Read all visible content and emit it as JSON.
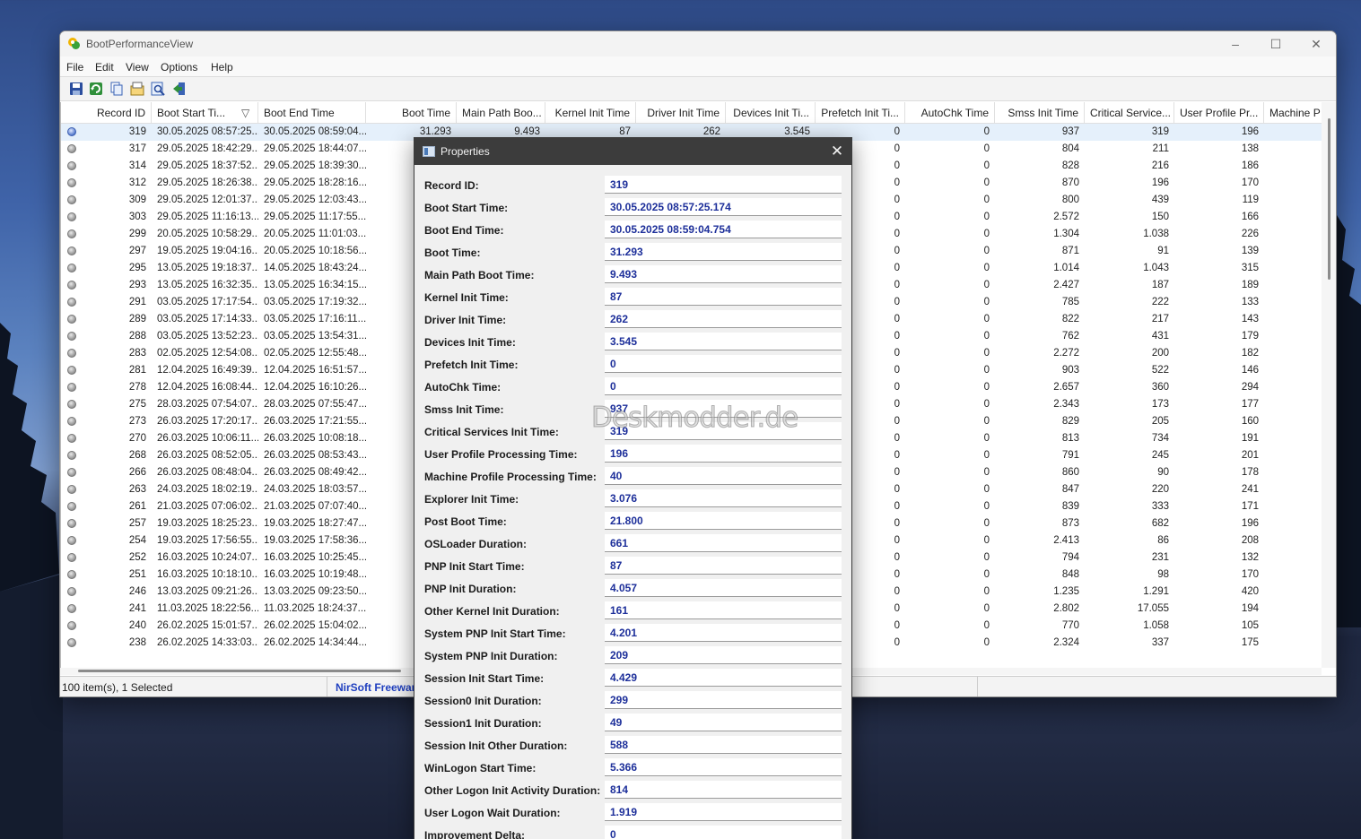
{
  "window": {
    "title": "BootPerformanceView",
    "controls": {
      "minimize": "–",
      "maximize": "☐",
      "close": "✕"
    }
  },
  "menu": [
    "File",
    "Edit",
    "View",
    "Options",
    "Help"
  ],
  "toolbar_icons": [
    "save-icon",
    "refresh-icon",
    "copy-icon",
    "properties-icon",
    "find-icon",
    "exit-icon"
  ],
  "columns": [
    "Record ID",
    "Boot Start Ti...",
    "Boot End Time",
    "Boot Time",
    "Main Path Boo...",
    "Kernel Init Time",
    "Driver Init Time",
    "Devices Init Ti...",
    "Prefetch Init Ti...",
    "AutoChk Time",
    "Smss Init Time",
    "Critical Service...",
    "User Profile Pr...",
    "Machine P"
  ],
  "sort_indicator": "▽",
  "rows": [
    {
      "id": "319",
      "start": "30.05.2025 08:57:25...",
      "end": "30.05.2025 08:59:04...",
      "boot": "31.293",
      "main": "9.493",
      "kernel": "87",
      "driver": "262",
      "devices": "3.545",
      "prefetch": "0",
      "autochk": "0",
      "smss": "937",
      "critical": "319",
      "user": "196",
      "selected": true
    },
    {
      "id": "317",
      "start": "29.05.2025 18:42:29...",
      "end": "29.05.2025 18:44:07...",
      "prefetch": "0",
      "autochk": "0",
      "smss": "804",
      "critical": "211",
      "user": "138"
    },
    {
      "id": "314",
      "start": "29.05.2025 18:37:52...",
      "end": "29.05.2025 18:39:30...",
      "prefetch": "0",
      "autochk": "0",
      "smss": "828",
      "critical": "216",
      "user": "186"
    },
    {
      "id": "312",
      "start": "29.05.2025 18:26:38...",
      "end": "29.05.2025 18:28:16...",
      "prefetch": "0",
      "autochk": "0",
      "smss": "870",
      "critical": "196",
      "user": "170"
    },
    {
      "id": "309",
      "start": "29.05.2025 12:01:37...",
      "end": "29.05.2025 12:03:43...",
      "prefetch": "0",
      "autochk": "0",
      "smss": "800",
      "critical": "439",
      "user": "119"
    },
    {
      "id": "303",
      "start": "29.05.2025 11:16:13...",
      "end": "29.05.2025 11:17:55...",
      "prefetch": "0",
      "autochk": "0",
      "smss": "2.572",
      "critical": "150",
      "user": "166"
    },
    {
      "id": "299",
      "start": "20.05.2025 10:58:29...",
      "end": "20.05.2025 11:01:03...",
      "prefetch": "0",
      "autochk": "0",
      "smss": "1.304",
      "critical": "1.038",
      "user": "226"
    },
    {
      "id": "297",
      "start": "19.05.2025 19:04:16...",
      "end": "20.05.2025 10:18:56...",
      "prefetch": "0",
      "autochk": "0",
      "smss": "871",
      "critical": "91",
      "user": "139"
    },
    {
      "id": "295",
      "start": "13.05.2025 19:18:37...",
      "end": "14.05.2025 18:43:24...",
      "prefetch": "0",
      "autochk": "0",
      "smss": "1.014",
      "critical": "1.043",
      "user": "315"
    },
    {
      "id": "293",
      "start": "13.05.2025 16:32:35...",
      "end": "13.05.2025 16:34:15...",
      "prefetch": "0",
      "autochk": "0",
      "smss": "2.427",
      "critical": "187",
      "user": "189"
    },
    {
      "id": "291",
      "start": "03.05.2025 17:17:54...",
      "end": "03.05.2025 17:19:32...",
      "prefetch": "0",
      "autochk": "0",
      "smss": "785",
      "critical": "222",
      "user": "133"
    },
    {
      "id": "289",
      "start": "03.05.2025 17:14:33...",
      "end": "03.05.2025 17:16:11...",
      "prefetch": "0",
      "autochk": "0",
      "smss": "822",
      "critical": "217",
      "user": "143"
    },
    {
      "id": "288",
      "start": "03.05.2025 13:52:23...",
      "end": "03.05.2025 13:54:31...",
      "prefetch": "0",
      "autochk": "0",
      "smss": "762",
      "critical": "431",
      "user": "179"
    },
    {
      "id": "283",
      "start": "02.05.2025 12:54:08...",
      "end": "02.05.2025 12:55:48...",
      "prefetch": "0",
      "autochk": "0",
      "smss": "2.272",
      "critical": "200",
      "user": "182"
    },
    {
      "id": "281",
      "start": "12.04.2025 16:49:39...",
      "end": "12.04.2025 16:51:57...",
      "prefetch": "0",
      "autochk": "0",
      "smss": "903",
      "critical": "522",
      "user": "146"
    },
    {
      "id": "278",
      "start": "12.04.2025 16:08:44...",
      "end": "12.04.2025 16:10:26...",
      "prefetch": "0",
      "autochk": "0",
      "smss": "2.657",
      "critical": "360",
      "user": "294"
    },
    {
      "id": "275",
      "start": "28.03.2025 07:54:07...",
      "end": "28.03.2025 07:55:47...",
      "prefetch": "0",
      "autochk": "0",
      "smss": "2.343",
      "critical": "173",
      "user": "177"
    },
    {
      "id": "273",
      "start": "26.03.2025 17:20:17...",
      "end": "26.03.2025 17:21:55...",
      "prefetch": "0",
      "autochk": "0",
      "smss": "829",
      "critical": "205",
      "user": "160"
    },
    {
      "id": "270",
      "start": "26.03.2025 10:06:11...",
      "end": "26.03.2025 10:08:18...",
      "prefetch": "0",
      "autochk": "0",
      "smss": "813",
      "critical": "734",
      "user": "191"
    },
    {
      "id": "268",
      "start": "26.03.2025 08:52:05...",
      "end": "26.03.2025 08:53:43...",
      "prefetch": "0",
      "autochk": "0",
      "smss": "791",
      "critical": "245",
      "user": "201"
    },
    {
      "id": "266",
      "start": "26.03.2025 08:48:04...",
      "end": "26.03.2025 08:49:42...",
      "prefetch": "0",
      "autochk": "0",
      "smss": "860",
      "critical": "90",
      "user": "178"
    },
    {
      "id": "263",
      "start": "24.03.2025 18:02:19...",
      "end": "24.03.2025 18:03:57...",
      "prefetch": "0",
      "autochk": "0",
      "smss": "847",
      "critical": "220",
      "user": "241"
    },
    {
      "id": "261",
      "start": "21.03.2025 07:06:02...",
      "end": "21.03.2025 07:07:40...",
      "prefetch": "0",
      "autochk": "0",
      "smss": "839",
      "critical": "333",
      "user": "171"
    },
    {
      "id": "257",
      "start": "19.03.2025 18:25:23...",
      "end": "19.03.2025 18:27:47...",
      "prefetch": "0",
      "autochk": "0",
      "smss": "873",
      "critical": "682",
      "user": "196"
    },
    {
      "id": "254",
      "start": "19.03.2025 17:56:55...",
      "end": "19.03.2025 17:58:36...",
      "prefetch": "0",
      "autochk": "0",
      "smss": "2.413",
      "critical": "86",
      "user": "208"
    },
    {
      "id": "252",
      "start": "16.03.2025 10:24:07...",
      "end": "16.03.2025 10:25:45...",
      "prefetch": "0",
      "autochk": "0",
      "smss": "794",
      "critical": "231",
      "user": "132"
    },
    {
      "id": "251",
      "start": "16.03.2025 10:18:10...",
      "end": "16.03.2025 10:19:48...",
      "prefetch": "0",
      "autochk": "0",
      "smss": "848",
      "critical": "98",
      "user": "170"
    },
    {
      "id": "246",
      "start": "13.03.2025 09:21:26...",
      "end": "13.03.2025 09:23:50...",
      "prefetch": "0",
      "autochk": "0",
      "smss": "1.235",
      "critical": "1.291",
      "user": "420"
    },
    {
      "id": "241",
      "start": "11.03.2025 18:22:56...",
      "end": "11.03.2025 18:24:37...",
      "prefetch": "0",
      "autochk": "0",
      "smss": "2.802",
      "critical": "17.055",
      "user": "194"
    },
    {
      "id": "240",
      "start": "26.02.2025 15:01:57...",
      "end": "26.02.2025 15:04:02...",
      "prefetch": "0",
      "autochk": "0",
      "smss": "770",
      "critical": "1.058",
      "user": "105"
    },
    {
      "id": "238",
      "start": "26.02.2025 14:33:03...",
      "end": "26.02.2025 14:34:44...",
      "prefetch": "0",
      "autochk": "0",
      "smss": "2.324",
      "critical": "337",
      "user": "175"
    }
  ],
  "status": {
    "count": "100 item(s), 1 Selected",
    "link": "NirSoft Freewar"
  },
  "properties": {
    "title": "Properties",
    "close": "✕",
    "fields": [
      {
        "label": "Record ID:",
        "value": "319"
      },
      {
        "label": "Boot Start Time:",
        "value": "30.05.2025 08:57:25.174"
      },
      {
        "label": "Boot End Time:",
        "value": "30.05.2025 08:59:04.754"
      },
      {
        "label": "Boot Time:",
        "value": "31.293"
      },
      {
        "label": "Main Path Boot Time:",
        "value": "9.493"
      },
      {
        "label": "Kernel Init Time:",
        "value": "87"
      },
      {
        "label": "Driver Init Time:",
        "value": "262"
      },
      {
        "label": "Devices Init Time:",
        "value": "3.545"
      },
      {
        "label": "Prefetch Init Time:",
        "value": "0"
      },
      {
        "label": "AutoChk Time:",
        "value": "0"
      },
      {
        "label": "Smss Init Time:",
        "value": "937"
      },
      {
        "label": "Critical Services Init Time:",
        "value": "319"
      },
      {
        "label": "User Profile Processing Time:",
        "value": "196"
      },
      {
        "label": "Machine Profile Processing Time:",
        "value": "40"
      },
      {
        "label": "Explorer Init Time:",
        "value": "3.076"
      },
      {
        "label": "Post Boot Time:",
        "value": "21.800"
      },
      {
        "label": "OSLoader Duration:",
        "value": "661"
      },
      {
        "label": "PNP Init Start Time:",
        "value": "87"
      },
      {
        "label": "PNP Init Duration:",
        "value": "4.057"
      },
      {
        "label": "Other Kernel Init Duration:",
        "value": "161"
      },
      {
        "label": "System PNP Init Start Time:",
        "value": "4.201"
      },
      {
        "label": "System PNP Init Duration:",
        "value": "209"
      },
      {
        "label": "Session Init Start Time:",
        "value": "4.429"
      },
      {
        "label": "Session0 Init Duration:",
        "value": "299"
      },
      {
        "label": "Session1 Init Duration:",
        "value": "49"
      },
      {
        "label": "Session Init Other Duration:",
        "value": "588"
      },
      {
        "label": "WinLogon Start Time:",
        "value": "5.366"
      },
      {
        "label": "Other Logon Init Activity Duration:",
        "value": "814"
      },
      {
        "label": "User Logon Wait Duration:",
        "value": "1.919"
      },
      {
        "label": "Improvement Delta:",
        "value": "0"
      }
    ]
  },
  "watermark": "Deskmodder.de"
}
